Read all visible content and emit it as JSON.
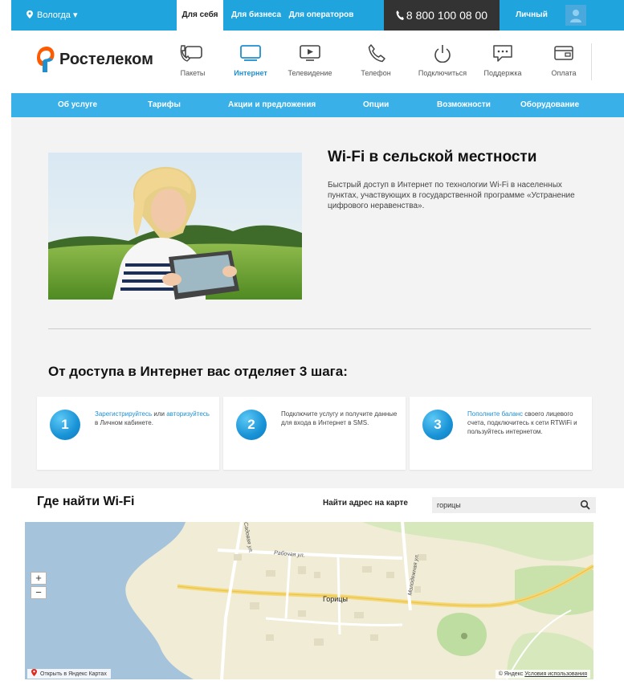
{
  "topbar": {
    "city": "Вологда ▾",
    "tabs": [
      "Для себя",
      "Для бизнеса",
      "Для операторов"
    ],
    "phone": "8 800 100 08 00",
    "cabinet": "Личный кабинет"
  },
  "header": {
    "logo": "Ростелеком",
    "nav": [
      {
        "label": "Пакеты",
        "icon": "packages-icon"
      },
      {
        "label": "Интернет",
        "icon": "monitor-icon"
      },
      {
        "label": "Телевидение",
        "icon": "tv-icon"
      },
      {
        "label": "Телефон",
        "icon": "phone-icon"
      },
      {
        "label": "Подключиться",
        "icon": "power-icon"
      },
      {
        "label": "Поддержка",
        "icon": "chat-icon"
      },
      {
        "label": "Оплата",
        "icon": "wallet-icon"
      }
    ],
    "active_nav": "Интернет"
  },
  "subnav": [
    "Об услуге",
    "Тарифы",
    "Акции и предложения",
    "Опции",
    "Возможности",
    "Оборудование"
  ],
  "hero": {
    "title": "Wi-Fi в сельской местности",
    "text": "Быстрый доступ в Интернет по технологии Wi-Fi в населенных пунктах, участвующих в государственной программе «Устранение цифрового неравенства»."
  },
  "steps": {
    "title": "От доступа в Интернет вас отделяет 3 шага:",
    "items": [
      {
        "num": "1",
        "link1": "Зарегистрируйтесь",
        "t1": " или ",
        "link2": "авторизуйтесь",
        "t2": " в Личном кабинете."
      },
      {
        "num": "2",
        "t1": "Подключите услугу и получите данные для входа в Интернет в SMS."
      },
      {
        "num": "3",
        "link1": "Пополните баланс",
        "t1": " своего лицевого счета, подключитесь к сети RTWiFi и пользуйтесь интернетом."
      }
    ]
  },
  "map": {
    "title": "Где найти Wi-Fi",
    "find_label": "Найти адрес на карте",
    "search_value": "горицы",
    "labels": {
      "village": "Горицы",
      "street1": "Рабочая ул.",
      "street2": "Молодежная ул.",
      "street3": "Садовая ул."
    },
    "zoom_in": "+",
    "zoom_out": "−",
    "open_link": "Открыть в Яндекс Картах",
    "copyright": "© Яндекс",
    "terms": "Условия использования"
  },
  "colors": {
    "accent": "#1fa4dd",
    "subnav": "#3ab0e8",
    "link": "#1f8fd0",
    "dark": "#333333"
  }
}
